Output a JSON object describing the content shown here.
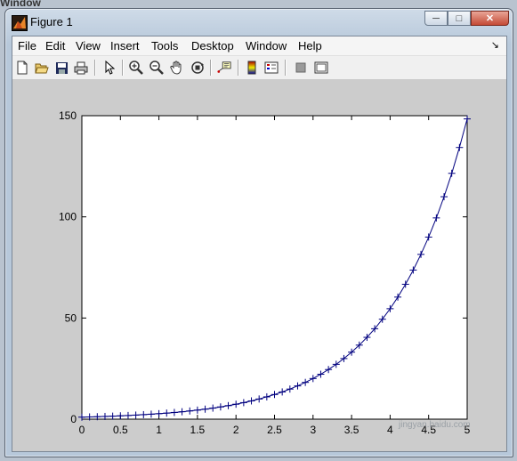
{
  "background_window_label": "Window",
  "window": {
    "title": "Figure 1",
    "minimize_label": "─",
    "maximize_label": "□",
    "close_label": "✕"
  },
  "menu": {
    "items": [
      "File",
      "Edit",
      "View",
      "Insert",
      "Tools",
      "Desktop",
      "Window",
      "Help"
    ],
    "overflow_label": "↘"
  },
  "toolbar": {
    "buttons": [
      "new-figure",
      "open-file",
      "save",
      "print",
      "edit-plot-arrow",
      "zoom-in",
      "zoom-out",
      "pan",
      "rotate-3d",
      "data-cursor",
      "insert-colorbar",
      "insert-legend",
      "hide-plot-tools",
      "show-plot-tools"
    ]
  },
  "colors": {
    "line": "#00007f",
    "axes_bg": "#ffffff",
    "figure_bg": "#cccccc"
  },
  "watermark": "jingyan.baidu.com",
  "chart_data": {
    "type": "line",
    "marker": "+",
    "title": "",
    "xlabel": "",
    "ylabel": "",
    "xlim": [
      0,
      5
    ],
    "ylim": [
      0,
      150
    ],
    "xticks": [
      "0",
      "0.5",
      "1",
      "1.5",
      "2",
      "2.5",
      "3",
      "3.5",
      "4",
      "4.5",
      "5"
    ],
    "yticks": [
      "0",
      "50",
      "100",
      "150"
    ],
    "series": [
      {
        "x": [
          0,
          0.1,
          0.2,
          0.3,
          0.4,
          0.5,
          0.6,
          0.7,
          0.8,
          0.9,
          1,
          1.1,
          1.2,
          1.3,
          1.4,
          1.5,
          1.6,
          1.7,
          1.8,
          1.9,
          2,
          2.1,
          2.2,
          2.3,
          2.4,
          2.5,
          2.6,
          2.7,
          2.8,
          2.9,
          3,
          3.1,
          3.2,
          3.3,
          3.4,
          3.5,
          3.6,
          3.7,
          3.8,
          3.9,
          4,
          4.1,
          4.2,
          4.3,
          4.4,
          4.5,
          4.6,
          4.7,
          4.8,
          4.9,
          5
        ],
        "y": [
          1.0,
          1.11,
          1.22,
          1.35,
          1.49,
          1.65,
          1.82,
          2.01,
          2.23,
          2.46,
          2.72,
          3.0,
          3.32,
          3.67,
          4.06,
          4.48,
          4.95,
          5.47,
          6.05,
          6.69,
          7.39,
          8.17,
          9.03,
          9.97,
          11.02,
          12.18,
          13.46,
          14.88,
          16.44,
          18.17,
          20.09,
          22.2,
          24.53,
          27.11,
          29.96,
          33.12,
          36.6,
          40.45,
          44.7,
          49.4,
          54.6,
          60.34,
          66.69,
          73.7,
          81.45,
          90.02,
          99.48,
          109.95,
          121.51,
          134.29,
          148.41
        ]
      }
    ]
  }
}
